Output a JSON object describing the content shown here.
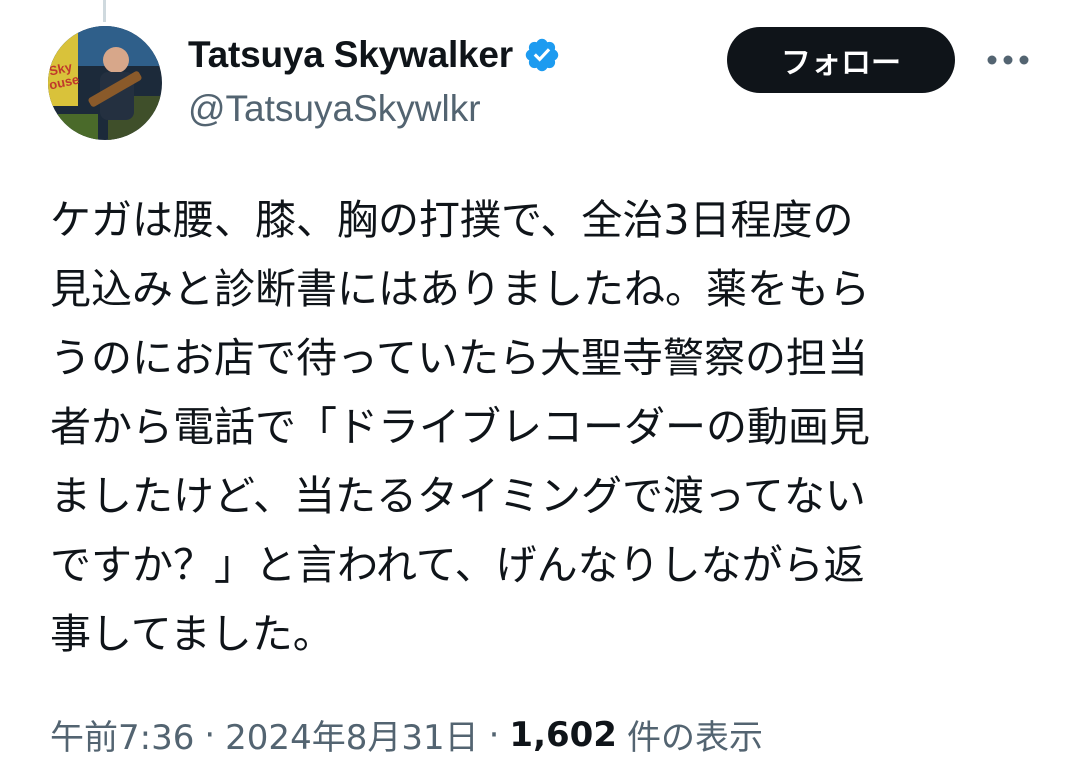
{
  "author": {
    "display_name": "Tatsuya Skywalker",
    "handle": "@TatsuyaSkywlkr",
    "avatar_sign_text": "Sky\nouse",
    "verified_color": "#1d9bf0"
  },
  "actions": {
    "follow_label": "フォロー",
    "more_icon": "more-horizontal-icon"
  },
  "tweet": {
    "lines": [
      "ケガは腰、膝、胸の打撲で、全治3日程度の",
      "見込みと診断書にはありましたね。薬をもら",
      "うのにお店で待っていたら大聖寺警察の担当",
      "者から電話で「ドライブレコーダーの動画見",
      "ましたけど、当たるタイミングで渡ってない",
      "ですか？」と言われて、げんなりしながら返",
      "事してました。"
    ]
  },
  "meta": {
    "time": "午前7:36",
    "separator": "·",
    "date": "2024年8月31日",
    "views_count": "1,602",
    "views_label": "件の表示"
  }
}
